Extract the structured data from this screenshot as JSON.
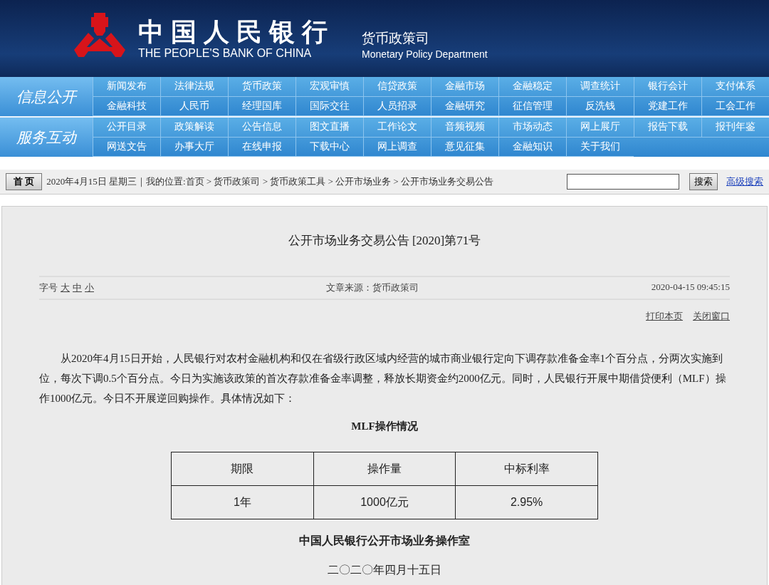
{
  "header": {
    "bank_name_cn": "中国人民银行",
    "bank_name_en": "THE PEOPLE'S BANK OF CHINA",
    "dept_cn": "货币政策司",
    "dept_en": "Monetary Policy Department"
  },
  "nav_groups": [
    {
      "label": "信息公开",
      "items": [
        "新闻发布",
        "法律法规",
        "货币政策",
        "宏观审慎",
        "信贷政策",
        "金融市场",
        "金融稳定",
        "调查统计",
        "银行会计",
        "支付体系",
        "金融科技",
        "人民币",
        "经理国库",
        "国际交往",
        "人员招录",
        "金融研究",
        "征信管理",
        "反洗钱",
        "党建工作",
        "工会工作"
      ]
    },
    {
      "label": "服务互动",
      "items": [
        "公开目录",
        "政策解读",
        "公告信息",
        "图文直播",
        "工作论文",
        "音频视频",
        "市场动态",
        "网上展厅",
        "报告下载",
        "报刊年鉴",
        "网送文告",
        "办事大厅",
        "在线申报",
        "下载中心",
        "网上调查",
        "意见征集",
        "金融知识",
        "关于我们"
      ]
    }
  ],
  "breadcrumb_bar": {
    "home_button": "首 页",
    "location": "2020年4月15日 星期三｜我的位置:首页 > 货币政策司 > 货币政策工具 > 公开市场业务 > 公开市场业务交易公告",
    "search_button": "搜索",
    "advanced_search": "高级搜索"
  },
  "article": {
    "title": "公开市场业务交易公告 [2020]第71号",
    "font_size_label": "字号",
    "font_sizes": [
      "大",
      "中",
      "小"
    ],
    "source": "文章来源：货币政策司",
    "datetime": "2020-04-15 09:45:15",
    "actions": [
      "打印本页",
      "关闭窗口"
    ],
    "paragraph": "从2020年4月15日开始，人民银行对农村金融机构和仅在省级行政区域内经营的城市商业银行定向下调存款准备金率1个百分点，分两次实施到位，每次下调0.5个百分点。今日为实施该政策的首次存款准备金率调整，释放长期资金约2000亿元。同时，人民银行开展中期借贷便利（MLF）操作1000亿元。今日不开展逆回购操作。具体情况如下：",
    "table_title": "MLF操作情况",
    "table": {
      "columns": [
        "期限",
        "操作量",
        "中标利率"
      ],
      "rows": [
        [
          "1年",
          "1000亿元",
          "2.95%"
        ]
      ]
    },
    "signature": "中国人民银行公开市场业务操作室",
    "date": "二〇二〇年四月十五日"
  }
}
